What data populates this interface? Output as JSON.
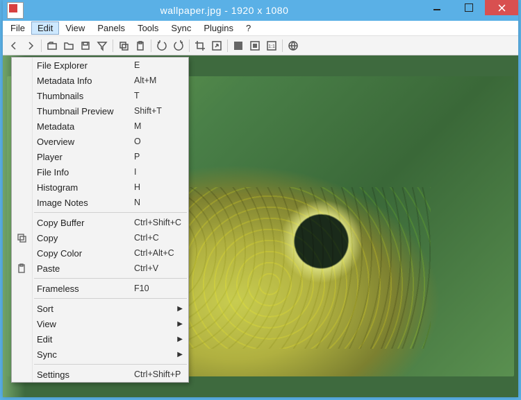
{
  "window": {
    "title": "wallpaper.jpg  -  1920 x 1080"
  },
  "menubar": {
    "items": [
      "File",
      "Edit",
      "View",
      "Panels",
      "Tools",
      "Sync",
      "Plugins",
      "?"
    ],
    "activeIndex": 1
  },
  "dropdown": {
    "groups": [
      [
        {
          "label": "File Explorer",
          "accel": "E"
        },
        {
          "label": "Metadata Info",
          "accel": "Alt+M"
        },
        {
          "label": "Thumbnails",
          "accel": "T"
        },
        {
          "label": "Thumbnail Preview",
          "accel": "Shift+T"
        },
        {
          "label": "Metadata",
          "accel": "M"
        },
        {
          "label": "Overview",
          "accel": "O"
        },
        {
          "label": "Player",
          "accel": "P"
        },
        {
          "label": "File Info",
          "accel": "I"
        },
        {
          "label": "Histogram",
          "accel": "H"
        },
        {
          "label": "Image Notes",
          "accel": "N"
        }
      ],
      [
        {
          "label": "Copy Buffer",
          "accel": "Ctrl+Shift+C"
        },
        {
          "label": "Copy",
          "accel": "Ctrl+C",
          "icon": "copy"
        },
        {
          "label": "Copy Color",
          "accel": "Ctrl+Alt+C"
        },
        {
          "label": "Paste",
          "accel": "Ctrl+V",
          "icon": "paste"
        }
      ],
      [
        {
          "label": "Frameless",
          "accel": "F10"
        }
      ],
      [
        {
          "label": "Sort",
          "submenu": true
        },
        {
          "label": "View",
          "submenu": true
        },
        {
          "label": "Edit",
          "submenu": true
        },
        {
          "label": "Sync",
          "submenu": true
        }
      ],
      [
        {
          "label": "Settings",
          "accel": "Ctrl+Shift+P"
        }
      ]
    ]
  },
  "toolbar": {
    "buttons": [
      {
        "name": "back-icon"
      },
      {
        "name": "forward-icon"
      },
      {
        "sep": true
      },
      {
        "name": "open-icon"
      },
      {
        "name": "folder-icon"
      },
      {
        "name": "save-icon"
      },
      {
        "name": "filter-icon"
      },
      {
        "sep": true
      },
      {
        "name": "copy-icon"
      },
      {
        "name": "paste-icon"
      },
      {
        "sep": true
      },
      {
        "name": "rotate-ccw-icon"
      },
      {
        "name": "rotate-cw-icon"
      },
      {
        "sep": true
      },
      {
        "name": "crop-icon"
      },
      {
        "name": "resize-icon"
      },
      {
        "sep": true
      },
      {
        "name": "fullscreen-icon"
      },
      {
        "name": "fit-icon"
      },
      {
        "name": "actual-size-icon"
      },
      {
        "sep": true
      },
      {
        "name": "globe-icon"
      }
    ]
  }
}
